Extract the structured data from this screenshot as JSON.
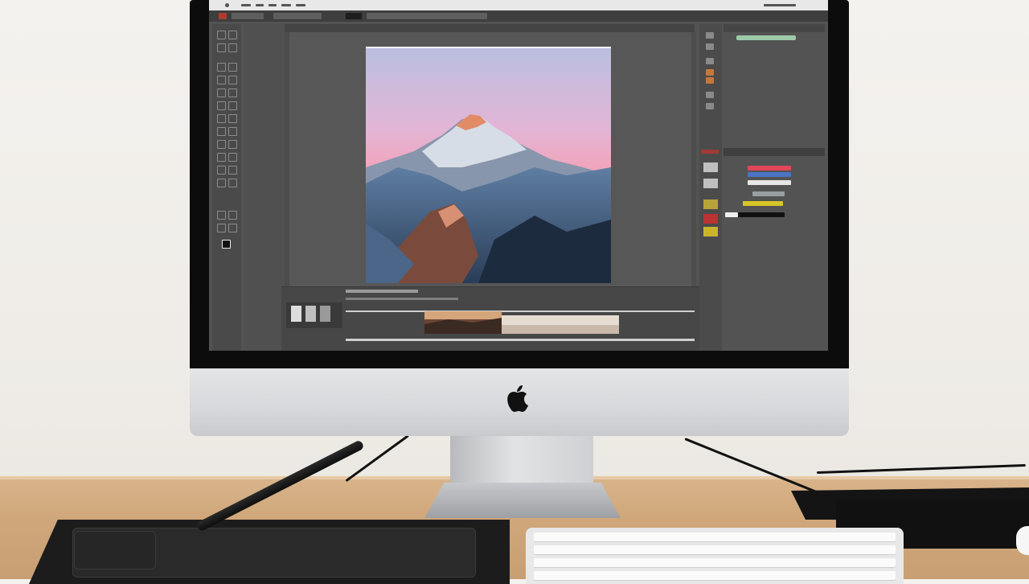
{
  "scene": {
    "description_visible_text": []
  },
  "screen": {
    "app_theme": "dark-gray",
    "accent_colors": {
      "sky_top": "#c9b7d9",
      "sky_mid": "#f3a1b5",
      "peak_glow": "#e28c67",
      "snow": "#d7dde6",
      "ice_blue": "#6f8fb1",
      "panel_green": "#9ec9a9",
      "swatch_red": "#e2465a",
      "swatch_blue": "#4b74c6",
      "swatch_yellow": "#d7c526"
    },
    "icons": [
      "apple-icon",
      "brush-icon",
      "layers-icon",
      "move-icon",
      "zoom-icon"
    ]
  }
}
